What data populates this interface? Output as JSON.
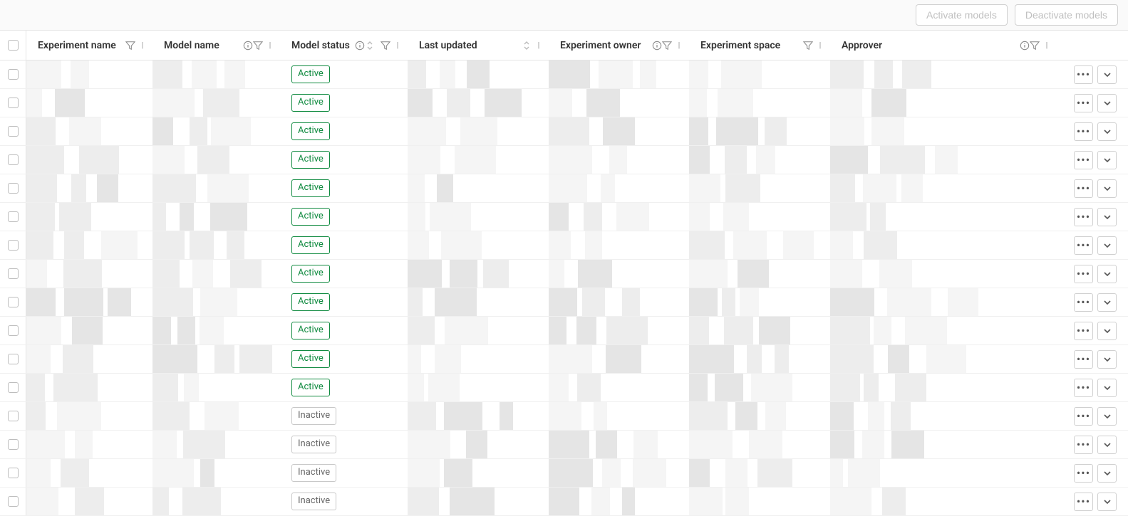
{
  "topbar": {
    "activate_label": "Activate models",
    "deactivate_label": "Deactivate models"
  },
  "columns": {
    "experiment_name": "Experiment name",
    "model_name": "Model name",
    "model_status": "Model status",
    "last_updated": "Last updated",
    "experiment_owner": "Experiment owner",
    "experiment_space": "Experiment space",
    "approver": "Approver"
  },
  "status_labels": {
    "active": "Active",
    "inactive": "Inactive"
  },
  "rows": [
    {
      "status": "active"
    },
    {
      "status": "active"
    },
    {
      "status": "active"
    },
    {
      "status": "active"
    },
    {
      "status": "active"
    },
    {
      "status": "active"
    },
    {
      "status": "active"
    },
    {
      "status": "active"
    },
    {
      "status": "active"
    },
    {
      "status": "active"
    },
    {
      "status": "active"
    },
    {
      "status": "active"
    },
    {
      "status": "inactive"
    },
    {
      "status": "inactive"
    },
    {
      "status": "inactive"
    },
    {
      "status": "inactive"
    }
  ]
}
